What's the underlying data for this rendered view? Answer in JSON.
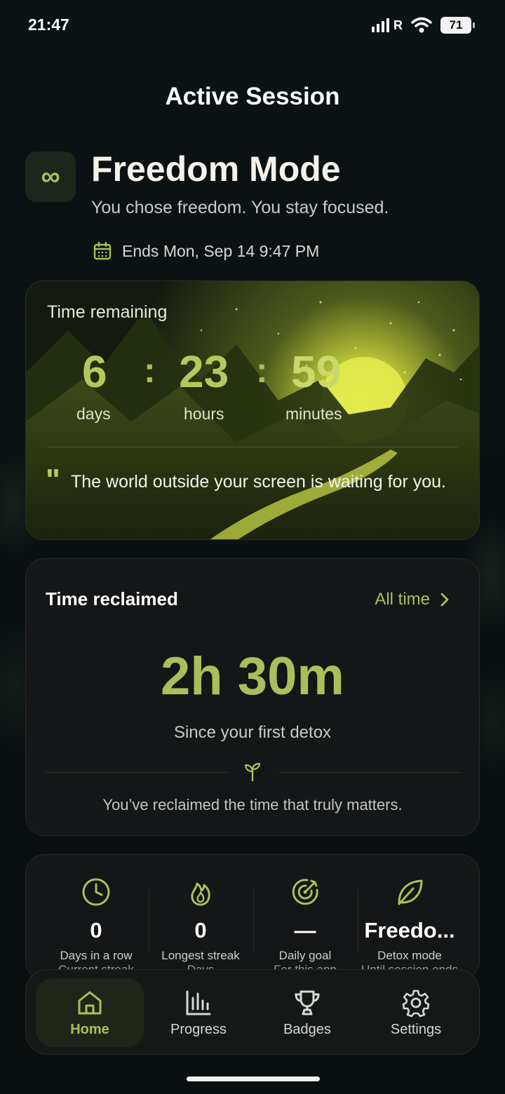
{
  "status_bar": {
    "time": "21:47",
    "carrier_badge": "R",
    "battery": "71"
  },
  "page_title": "Active Session",
  "mode": {
    "icon": "infinity-icon",
    "title": "Freedom Mode",
    "subtitle": "You chose freedom. You stay focused.",
    "ends_label": "Ends Mon, Sep 14 9:47 PM"
  },
  "timer": {
    "label": "Time remaining",
    "days_value": "6",
    "days_unit": "days",
    "hours_value": "23",
    "hours_unit": "hours",
    "minutes_value": "59",
    "minutes_unit": "minutes",
    "separator": ":",
    "quote_mark": "\"",
    "quote": "The world outside your screen is waiting for you."
  },
  "reclaimed": {
    "title": "Time reclaimed",
    "filter_label": "All time",
    "value": "2h 30m",
    "since": "Since your first detox",
    "message": "You’ve reclaimed the time that truly matters."
  },
  "stats": [
    {
      "icon": "clock-icon",
      "value": "0",
      "label": "Days in a row",
      "sublabel": "Current streak"
    },
    {
      "icon": "flame-icon",
      "value": "0",
      "label": "Longest streak",
      "sublabel": "Days"
    },
    {
      "icon": "target-icon",
      "value": "—",
      "label": "Daily goal",
      "sublabel": "For this app"
    },
    {
      "icon": "leaf-icon",
      "value": "Freedo...",
      "label": "Detox mode",
      "sublabel": "Until session ends"
    }
  ],
  "nav": [
    {
      "icon": "home-icon",
      "label": "Home",
      "active": true
    },
    {
      "icon": "bar-chart-icon",
      "label": "Progress",
      "active": false
    },
    {
      "icon": "trophy-icon",
      "label": "Badges",
      "active": false
    },
    {
      "icon": "gear-icon",
      "label": "Settings",
      "active": false
    }
  ],
  "colors": {
    "accent": "#a9c05a",
    "background": "#0b1012",
    "card": "#141617"
  }
}
